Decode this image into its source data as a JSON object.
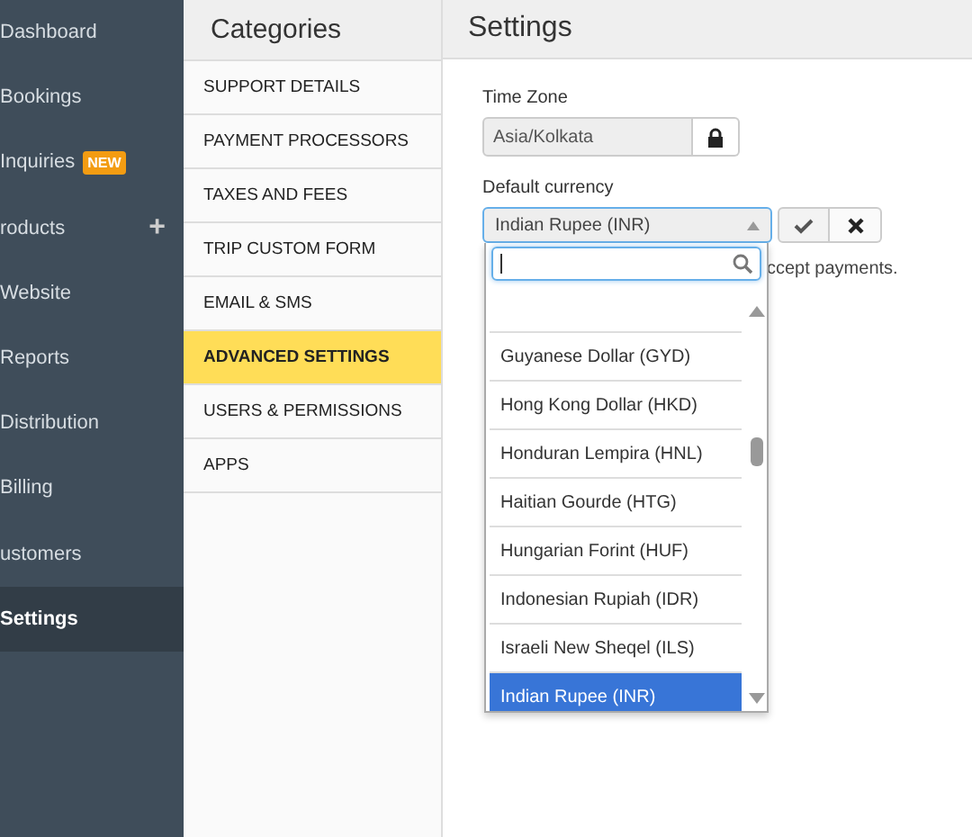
{
  "sidebar": {
    "items": [
      {
        "label": "Dashboard",
        "selected": false
      },
      {
        "label": "Bookings",
        "selected": false
      },
      {
        "label": "Inquiries",
        "badge": "NEW",
        "selected": false
      },
      {
        "label": "roducts",
        "action": "+",
        "selected": false
      },
      {
        "label": "Website",
        "selected": false
      },
      {
        "label": "Reports",
        "selected": false
      },
      {
        "label": "Distribution",
        "selected": false
      },
      {
        "label": "Billing",
        "selected": false
      },
      {
        "label": "ustomers",
        "selected": false
      },
      {
        "label": "Settings",
        "selected": true
      }
    ]
  },
  "categories": {
    "title": "Categories",
    "items": [
      {
        "label": "SUPPORT DETAILS",
        "selected": false
      },
      {
        "label": "PAYMENT PROCESSORS",
        "selected": false
      },
      {
        "label": "TAXES AND FEES",
        "selected": false
      },
      {
        "label": "TRIP CUSTOM FORM",
        "selected": false
      },
      {
        "label": "EMAIL & SMS",
        "selected": false
      },
      {
        "label": "ADVANCED SETTINGS",
        "selected": true
      },
      {
        "label": "USERS & PERMISSIONS",
        "selected": false
      },
      {
        "label": "APPS",
        "selected": false
      }
    ]
  },
  "settings": {
    "title": "Settings",
    "time_zone": {
      "label": "Time Zone",
      "value": "Asia/Kolkata",
      "locked": true
    },
    "currency": {
      "label": "Default currency",
      "value": "Indian Rupee (INR)",
      "hint": "ccept payments.",
      "dropdown": {
        "options": [
          {
            "label": "Guyanese Dollar (GYD)",
            "selected": false
          },
          {
            "label": "Hong Kong Dollar (HKD)",
            "selected": false
          },
          {
            "label": "Honduran Lempira (HNL)",
            "selected": false
          },
          {
            "label": "Haitian Gourde (HTG)",
            "selected": false
          },
          {
            "label": "Hungarian Forint (HUF)",
            "selected": false
          },
          {
            "label": "Indonesian Rupiah (IDR)",
            "selected": false
          },
          {
            "label": "Israeli New Sheqel (ILS)",
            "selected": false
          },
          {
            "label": "Indian Rupee (INR)",
            "selected": true
          }
        ]
      }
    }
  }
}
